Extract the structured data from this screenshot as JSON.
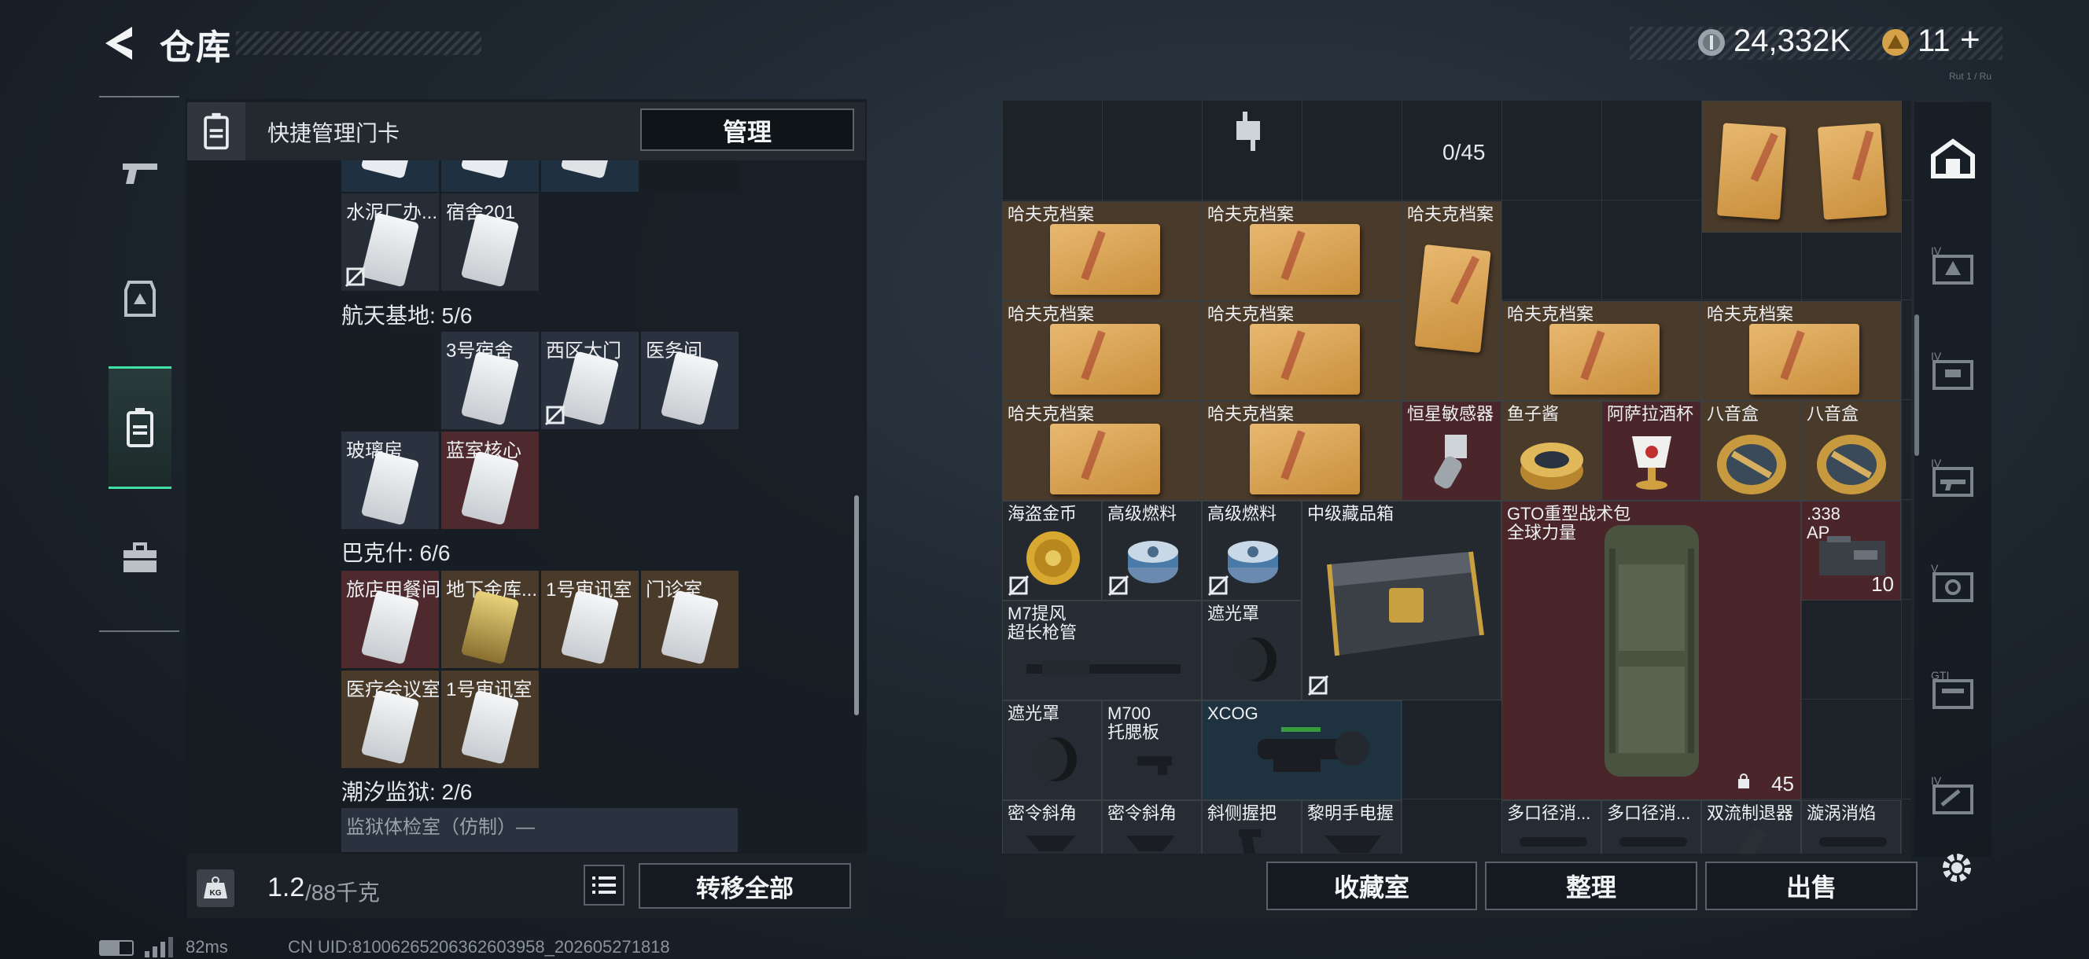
{
  "header": {
    "title": "仓库",
    "currency": "24,332K",
    "tokens": "11",
    "plus": "+",
    "tiny_tag": "Rut 1 / Ru"
  },
  "nav": {
    "items": [
      "weapon",
      "armor",
      "keycard",
      "toolbox"
    ]
  },
  "left_panel": {
    "header_label": "快捷管理门卡",
    "manage_button": "管理",
    "top_cards": [
      {
        "label": "水泥厂办..."
      },
      {
        "label": "宿舍201"
      }
    ],
    "sections": [
      {
        "title": "航天基地: 5/6",
        "cards": [
          "",
          "3号宿舍",
          "西区大门",
          "医务间",
          "玻璃房",
          "蓝室核心"
        ]
      },
      {
        "title": "巴克什: 6/6",
        "cards": [
          "旅店用餐间",
          "地下金库...",
          "1号审讯室",
          "门诊室",
          "医疗会议室",
          "1号审讯室"
        ]
      },
      {
        "title": "潮汐监狱: 2/6",
        "cards": [
          "监狱体检室（仿制）—"
        ]
      }
    ],
    "weight_icon": "KG",
    "weight_value": "1.2",
    "weight_total": "/88千克",
    "transfer_all": "转移全部"
  },
  "storage": {
    "count": "0/45",
    "items": {
      "hafuke": "哈夫克档案",
      "hengxing": "恒星敏感器",
      "yuzijiang": "鱼子酱",
      "alabei": "阿萨拉酒杯",
      "bayinhe": "八音盒",
      "haidao": "海盗金币",
      "gaoji": "高级燃料",
      "zhongji": "中级藏品箱",
      "gto": "GTO重型战术包\n全球力量",
      "ap": ".338\nAP",
      "ap_count": "10",
      "m7": "M7提风\n超长枪管",
      "zheguang": "遮光罩",
      "m700": "M700\n托腮板",
      "xcog": "XCOG",
      "bag_count": "45",
      "milingxie": "密令斜角",
      "xiece": "斜侧握把",
      "liming": "黎明手电握",
      "duokou": "多口径消...",
      "shuangliu": "双流制退器",
      "xuanwo": "漩涡消焰"
    }
  },
  "bottom_buttons": {
    "collection": "收藏室",
    "arrange": "整理",
    "sell": "出售"
  },
  "footer": {
    "ping": "82ms",
    "uid": "CN UID:81006265206362603958_202605271818"
  }
}
